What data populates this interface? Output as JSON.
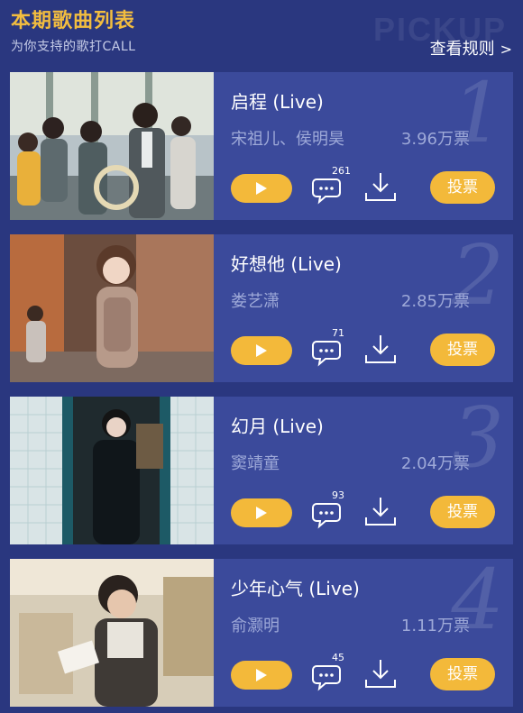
{
  "header": {
    "title": "本期歌曲列表",
    "subtitle": "为你支持的歌打CALL",
    "bg_text": "PICKUP",
    "rules_link": "查看规则",
    "rules_chevron": ">"
  },
  "colors": {
    "background": "#2a377f",
    "card": "#3b4a9b",
    "accent": "#f3b93a",
    "title": "#f2bd3f",
    "muted_text": "#9ea9d8"
  },
  "songs": [
    {
      "rank": "1",
      "title": "启程 (Live)",
      "artist": "宋祖儿、侯明昊",
      "votes": "3.96万票",
      "comments": "261",
      "vote_label": "投票"
    },
    {
      "rank": "2",
      "title": "好想他 (Live)",
      "artist": "娄艺潇",
      "votes": "2.85万票",
      "comments": "71",
      "vote_label": "投票"
    },
    {
      "rank": "3",
      "title": "幻月 (Live)",
      "artist": "窦靖童",
      "votes": "2.04万票",
      "comments": "93",
      "vote_label": "投票"
    },
    {
      "rank": "4",
      "title": "少年心气 (Live)",
      "artist": "俞灏明",
      "votes": "1.11万票",
      "comments": "45",
      "vote_label": "投票"
    }
  ],
  "icons": {
    "play": "play-icon",
    "comment": "comment-icon",
    "download": "download-icon"
  }
}
